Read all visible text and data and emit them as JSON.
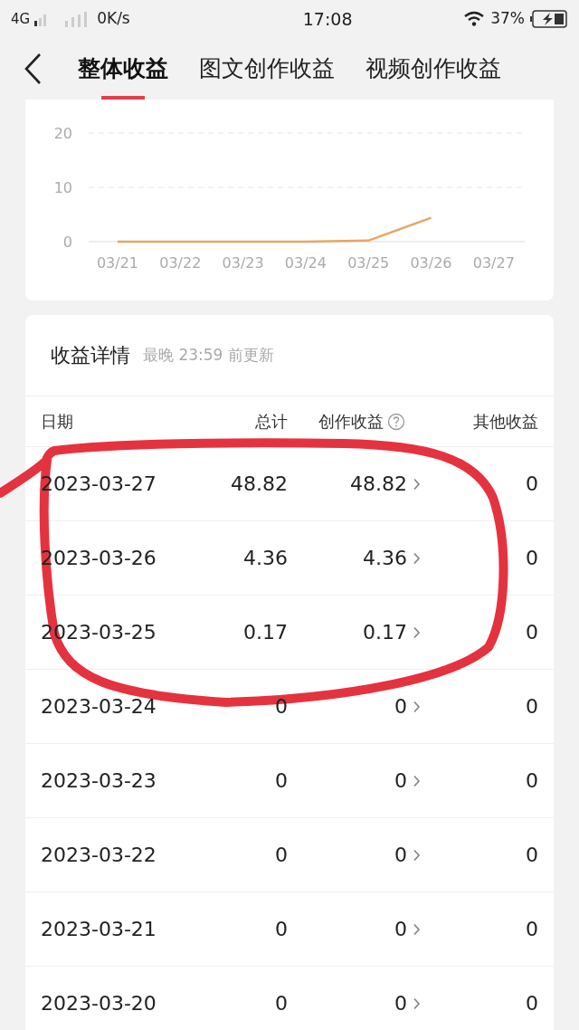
{
  "status_bar": {
    "network": "4G",
    "speed": "0K/s",
    "time": "17:08",
    "battery": "37%"
  },
  "tabs": [
    {
      "label": "整体收益",
      "selected": true
    },
    {
      "label": "图文创作收益",
      "selected": false
    },
    {
      "label": "视频创作收益",
      "selected": false
    }
  ],
  "trend": {
    "chart_data": {
      "type": "line",
      "categories": [
        "03/21",
        "03/22",
        "03/23",
        "03/24",
        "03/25",
        "03/26",
        "03/27"
      ],
      "series": [
        {
          "color": "#eba466",
          "values": [
            0,
            0,
            0,
            0,
            0.2,
            4.4,
            null
          ]
        }
      ],
      "ylim": [
        0,
        26
      ],
      "yticks": [
        0,
        10,
        20
      ]
    }
  },
  "details": {
    "title": "收益详情",
    "subtitle": "最晚 23:59 前更新",
    "columns": [
      {
        "label": "日期",
        "help": false
      },
      {
        "label": "总计",
        "help": false
      },
      {
        "label": "创作收益",
        "help": true
      },
      {
        "label": "其他收益",
        "help": false
      }
    ],
    "rows": [
      {
        "date": "2023-03-27",
        "total": "48.82",
        "creation": "48.82",
        "other": "0"
      },
      {
        "date": "2023-03-26",
        "total": "4.36",
        "creation": "4.36",
        "other": "0"
      },
      {
        "date": "2023-03-25",
        "total": "0.17",
        "creation": "0.17",
        "other": "0"
      },
      {
        "date": "2023-03-24",
        "total": "0",
        "creation": "0",
        "other": "0"
      },
      {
        "date": "2023-03-23",
        "total": "0",
        "creation": "0",
        "other": "0"
      },
      {
        "date": "2023-03-22",
        "total": "0",
        "creation": "0",
        "other": "0"
      },
      {
        "date": "2023-03-21",
        "total": "0",
        "creation": "0",
        "other": "0"
      },
      {
        "date": "2023-03-20",
        "total": "0",
        "creation": "0",
        "other": "0"
      }
    ]
  }
}
